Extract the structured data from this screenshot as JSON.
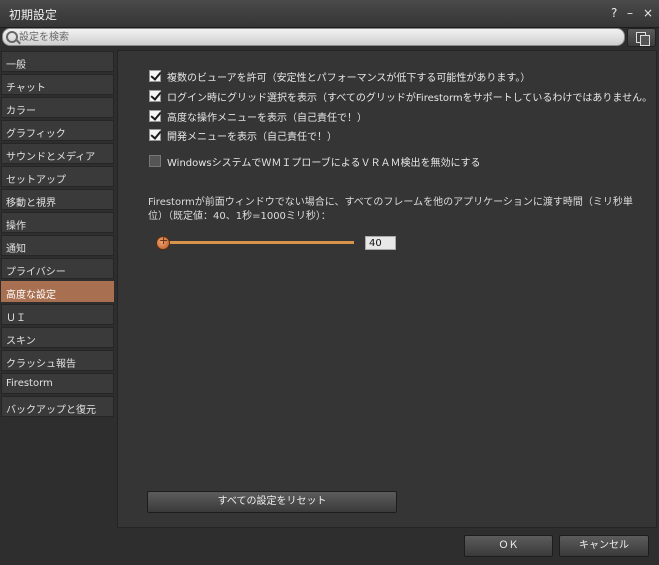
{
  "window": {
    "title": "初期設定",
    "help_label": "?",
    "minimize_label": "–",
    "close_label": "×"
  },
  "search": {
    "placeholder": "設定を検索"
  },
  "sidebar": {
    "items": [
      {
        "label": "一般"
      },
      {
        "label": "チャット"
      },
      {
        "label": "カラー"
      },
      {
        "label": "グラフィック"
      },
      {
        "label": "サウンドとメディア"
      },
      {
        "label": "セットアップ"
      },
      {
        "label": "移動と視界"
      },
      {
        "label": "操作"
      },
      {
        "label": "通知"
      },
      {
        "label": "プライバシー"
      },
      {
        "label": "高度な設定"
      },
      {
        "label": "ＵＩ"
      },
      {
        "label": "スキン"
      },
      {
        "label": "クラッシュ報告"
      },
      {
        "label": "Firestorm"
      },
      {
        "label": "バックアップと復元"
      }
    ],
    "active_index": 10
  },
  "panel": {
    "checkboxes": [
      {
        "label": "複数のビューアを許可（安定性とパフォーマンスが低下する可能性があります。）",
        "checked": true
      },
      {
        "label": "ログイン時にグリッド選択を表示（すべてのグリッドがFirestormをサポートしているわけではありません。",
        "checked": true
      },
      {
        "label": "高度な操作メニューを表示（自己責任で！）",
        "checked": true
      },
      {
        "label": "開発メニューを表示（自己責任で！）",
        "checked": true
      },
      {
        "label": "WindowsシステムでＷＭＩプローブによるＶＲＡＭ検出を無効にする",
        "checked": false
      }
    ],
    "frame_time_description": "Firestormが前面ウィンドウでない場合に、すべてのフレームを他のアプリケーションに渡す時間（ミリ秒単位）（既定値：40、1秒=1000ミリ秒）：",
    "slider": {
      "value": "40",
      "fraction": 0.0
    },
    "reset_label": "すべての設定をリセット"
  },
  "footer": {
    "ok_label": "ＯＫ",
    "cancel_label": "キャンセル"
  },
  "colors": {
    "active_item": "#a87050",
    "slider": "#d9944b"
  }
}
